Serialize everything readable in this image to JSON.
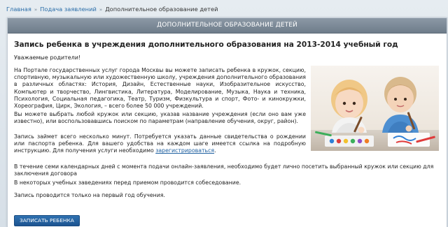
{
  "breadcrumb": {
    "items": [
      "Главная",
      "Подача заявлений"
    ],
    "current": "Дополнительное образование детей",
    "separator": "»"
  },
  "panel": {
    "header": "ДОПОЛНИТЕЛЬНОЕ ОБРАЗОВАНИЕ ДЕТЕЙ"
  },
  "main": {
    "title": "Запись ребенка в учреждения дополнительного образования на 2013-2014 учебный год",
    "greeting": "Уважаемые родители!",
    "p1": "На Портале государственных услуг города Москвы вы можете записать ребенка в кружок, секцию, спортивную, музыкальную или художественную школу, учреждения дополнительного образования в различных областях: История, Дизайн, Естественные науки, Изобразительное искусство, Компьютер и творчество, Лингвистика, Литература, Моделирование, Музыка, Наука и техника, Психология, Социальная педагогика, Театр, Туризм, Физкультура и спорт, Фото- и кинокружки, Хореография, Цирк, Экология, – всего более 50 000 учреждений.",
    "p2": "Вы можете выбрать любой кружок или секцию, указав название учреждения (если оно вам уже известно), или воспользовавшись поиском по параметрам (направление обучения, округ, район).",
    "p3_text": "Запись займет всего несколько минут. Потребуется указать данные свидетельства о рождении или паспорта ребенка. Для вашего удобства на каждом шаге имеется ссылка на подробную инструкцию. Для получения услуги необходимо",
    "p3_link": "зарегистрироваться",
    "p3_end": ".",
    "p4": "В течение семи календарных дней с момента подачи онлайн-заявления, необходимо будет лично посетить выбранный кружок или секцию для заключения договора",
    "p5": "В некоторых учебных заведениях перед приемом проводится собеседование.",
    "p6": "Запись проводится только на первый год обучения.",
    "button": "ЗАПИСАТЬ РЕБЕНКА"
  },
  "colors": {
    "header_bg": "#7f8c99",
    "link": "#2a6da8",
    "button": "#245f9e"
  }
}
